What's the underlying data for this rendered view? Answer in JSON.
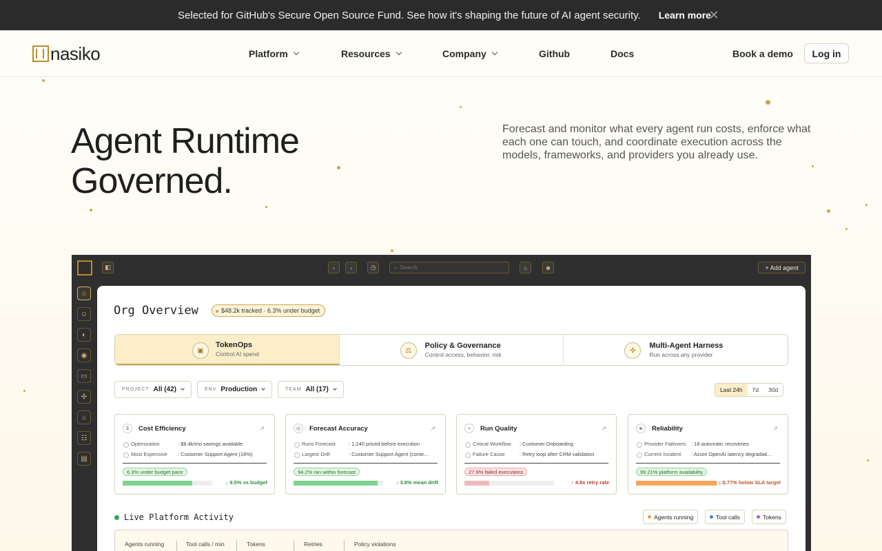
{
  "announcement": {
    "message": "Selected for GitHub's Secure Open Source Fund. See how it's shaping the future of AI agent security.",
    "cta": "Learn more",
    "close_icon": "close-icon"
  },
  "nav": {
    "logo_text": "nasiko",
    "items": [
      {
        "label": "Platform",
        "dropdown": true
      },
      {
        "label": "Resources",
        "dropdown": true
      },
      {
        "label": "Company",
        "dropdown": true
      },
      {
        "label": "Github",
        "dropdown": false
      },
      {
        "label": "Docs",
        "dropdown": false
      }
    ],
    "book_demo": "Book a demo",
    "login": "Log in"
  },
  "hero": {
    "title_line1": "Agent Runtime",
    "title_line2": "Governed.",
    "subtitle": "Forecast and monitor what every agent run costs, enforce what each one can touch, and coordinate execution across the models, frameworks, and providers you already use."
  },
  "app": {
    "search_placeholder": "Search",
    "add_agent": "+ Add agent",
    "org_title": "Org Overview",
    "budget_pill": "$48.2k tracked · 6.3% under budget",
    "tabs": [
      {
        "name": "TokenOps",
        "desc": "Control AI spend",
        "icon": "coin-icon",
        "active": true
      },
      {
        "name": "Policy & Governance",
        "desc": "Control access, behavior, risk",
        "icon": "scale-icon",
        "active": false
      },
      {
        "name": "Multi-Agent Harness",
        "desc": "Run across any provider",
        "icon": "puzzle-icon",
        "active": false
      }
    ],
    "filters": [
      {
        "key": "Project",
        "value": "All (42)"
      },
      {
        "key": "Env",
        "value": "Production"
      },
      {
        "key": "Team",
        "value": "All (17)"
      }
    ],
    "ranges": [
      "Last 24h",
      "7d",
      "30d"
    ],
    "active_range": "Last 24h",
    "cards": [
      {
        "title": "Cost Efficiency",
        "rows": [
          {
            "k": "Optimization",
            "v": ": $8.4k/mo savings available"
          },
          {
            "k": "Most Expensive",
            "v": ": Customer Support Agent (18%)"
          }
        ],
        "pill": "6.3% under budget pace",
        "pill_kind": "green",
        "delta": "↓ 9.5% vs budget",
        "delta_color": "#2e8b3d",
        "bar_fill": 0.78,
        "bar_color": "#7fd28f"
      },
      {
        "title": "Forecast Accuracy",
        "rows": [
          {
            "k": "Runs Forecast",
            "v": ": 1,240 priced before execution"
          },
          {
            "k": "Largest Drift",
            "v": ": Customer Support Agent (conte..."
          }
        ],
        "pill": "94.2% ran within forecast",
        "pill_kind": "green",
        "delta": "↓ 3.8% mean drift",
        "delta_color": "#2e8b3d",
        "bar_fill": 0.94,
        "bar_color": "#7fd28f"
      },
      {
        "title": "Run Quality",
        "rows": [
          {
            "k": "Critical Workflow",
            "v": ": Customer Onboarding"
          },
          {
            "k": "Failure Cause",
            "v": ": Retry loop after CRM validation"
          }
        ],
        "pill": "27.9% failed executions",
        "pill_kind": "red",
        "delta": "↑ 4.8x retry rate",
        "delta_color": "#c0392b",
        "bar_fill": 0.28,
        "bar_color": "#f2b9b9"
      },
      {
        "title": "Reliability",
        "rows": [
          {
            "k": "Provider Failovers",
            "v": ": 18 automatic recoveries"
          },
          {
            "k": "Current Incident",
            "v": ": Azure OpenAI latency degradati..."
          }
        ],
        "pill": "99.21% platform availability",
        "pill_kind": "green",
        "delta": "↓ 0.77% below SLA target",
        "delta_color": "#c0572b",
        "bar_fill": 0.9,
        "bar_color": "#f5a55a"
      }
    ],
    "live_title": "Live Platform Activity",
    "legend": [
      {
        "label": "Agents running",
        "color": "#d4a92e"
      },
      {
        "label": "Tool calls",
        "color": "#3b7ddd"
      },
      {
        "label": "Tokens",
        "color": "#a463d6"
      }
    ],
    "metrics": [
      "Agents running",
      "Tool calls / min",
      "Tokens",
      "Retries",
      "Policy violations"
    ]
  }
}
